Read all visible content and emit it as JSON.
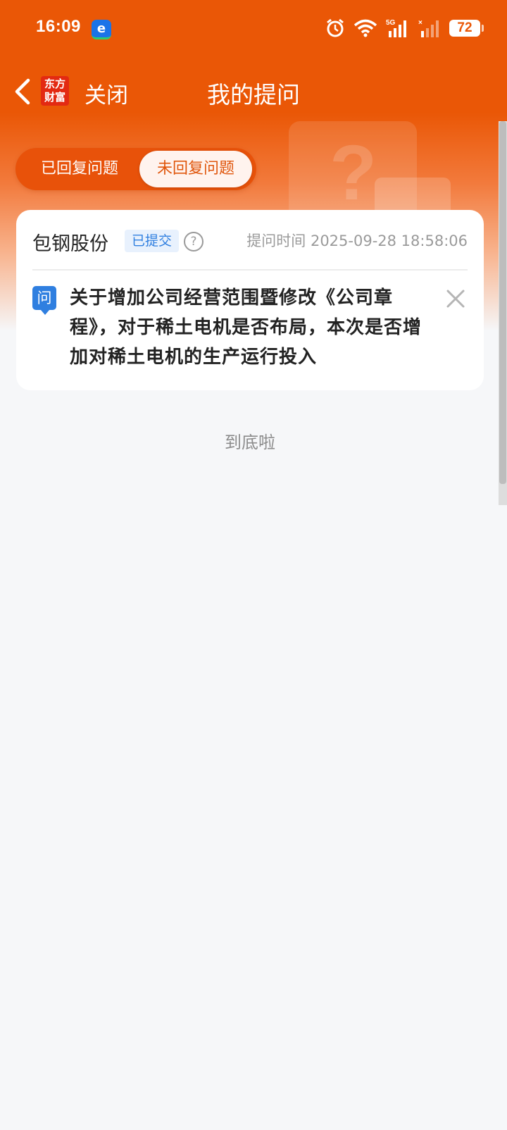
{
  "status_bar": {
    "time": "16:09",
    "notification_icon": "e-app-icon",
    "network": "5G",
    "battery": "72"
  },
  "nav": {
    "brand_logo_text": "东方财富",
    "close_label": "关闭",
    "title": "我的提问"
  },
  "tabs": [
    {
      "label": "已回复问题",
      "active": false
    },
    {
      "label": "未回复问题",
      "active": true
    }
  ],
  "question_card": {
    "stock_name": "包钢股份",
    "status_badge": "已提交",
    "help_icon": "?",
    "ask_time": "提问时间 2025-09-28 18:58:06",
    "q_label": "问",
    "question_text": "关于增加公司经营范围暨修改《公司章程》，对于稀土电机是否布局，本次是否增加对稀土电机的生产运行投入"
  },
  "footer": {
    "end_text": "到底啦"
  },
  "colors": {
    "brand_orange": "#ea5706",
    "badge_blue": "#2f7fe0",
    "background": "#f6f7f9"
  }
}
